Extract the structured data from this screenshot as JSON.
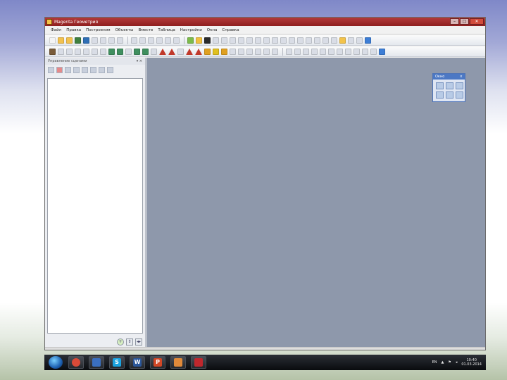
{
  "window": {
    "title": "Magenta Геометрия",
    "minimize": "–",
    "maximize": "□",
    "close": "✕"
  },
  "menu": [
    "Файл",
    "Правка",
    "Построения",
    "Объекты",
    "Вместе",
    "Таблица",
    "Настройки",
    "Окна",
    "Справка"
  ],
  "panel": {
    "title": "Управление сценами",
    "header_buttons": "▾ ×"
  },
  "floating_toolbox": {
    "title": "Окно",
    "close": "×"
  },
  "panel_bottom": {
    "zoom_in": "+",
    "zoom_fit": "↕",
    "play": "◂▸"
  },
  "tray": {
    "language": "EN",
    "time": "10:40",
    "date": "01.03.2014"
  },
  "taskbar": {
    "skype": "S",
    "word": "W",
    "powerpoint": "P"
  },
  "colors": {
    "title_bar": "#a32b2b",
    "workspace": "#8e98ab",
    "accent": "#4c78c4"
  }
}
